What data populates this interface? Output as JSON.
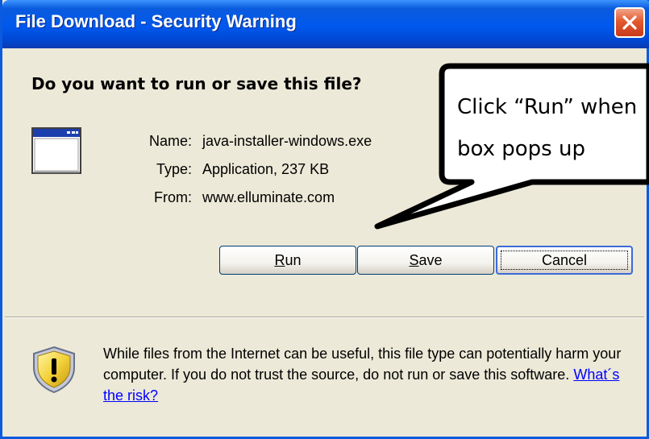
{
  "window": {
    "title": "File Download - Security Warning",
    "close_icon": "close-icon"
  },
  "prompt": {
    "question": "Do you want to run or save this file?"
  },
  "file": {
    "icon": "application-window-icon",
    "name_label": "Name:",
    "name_value": "java-installer-windows.exe",
    "type_label": "Type:",
    "type_value": "Application, 237 KB",
    "from_label": "From:",
    "from_value": "www.elluminate.com"
  },
  "buttons": {
    "run_prefix": "R",
    "run_rest": "un",
    "save_prefix": "S",
    "save_rest": "ave",
    "cancel": "Cancel"
  },
  "warning": {
    "icon": "shield-warning-icon",
    "text": "While files from the Internet can be useful, this file type can potentially harm your computer. If you do not trust the source, do not run or save this software.",
    "link": "What´s the risk?"
  },
  "callout": {
    "line1": "Click “Run” when",
    "line2": "box pops up"
  },
  "colors": {
    "title_bar": "#0A5BDD",
    "window_bg": "#ECE9D8",
    "link": "#0000FF",
    "close_button": "#E35A2E"
  }
}
